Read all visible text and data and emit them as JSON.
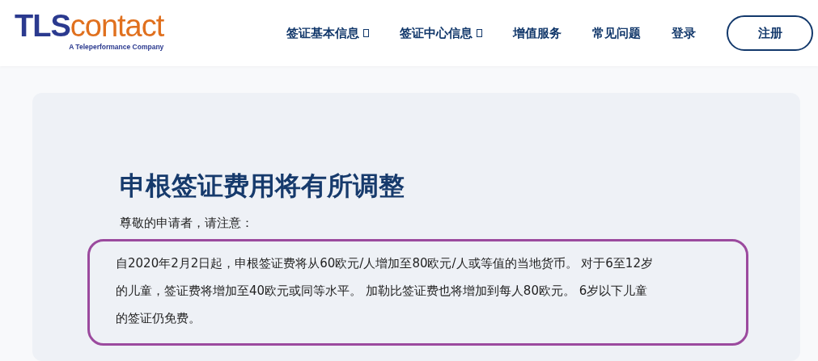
{
  "header": {
    "logo": {
      "primary": "TLS",
      "secondary": "contact",
      "tagline": "A Teleperformance Company"
    },
    "nav": [
      {
        "label": "签证基本信息",
        "has_dropdown": true
      },
      {
        "label": "签证中心信息",
        "has_dropdown": true
      },
      {
        "label": "增值服务",
        "has_dropdown": false
      },
      {
        "label": "常见问题",
        "has_dropdown": false
      },
      {
        "label": "登录",
        "has_dropdown": false
      }
    ],
    "register_button": "注册"
  },
  "notice": {
    "title": "申根签证费用将有所调整",
    "greeting": "尊敬的申请者，请注意：",
    "highlighted": true,
    "body_lines": [
      "自2020年2月2日起，申根签证费将从60欧元/人增加至80欧元/人或等值的当地货币。 对于6至12岁",
      "的儿童，签证费将增加至40欧元或同等水平。 加勒比签证费也将增加到每人80欧元。 6岁以下儿童",
      "的签证仍免费。"
    ]
  }
}
